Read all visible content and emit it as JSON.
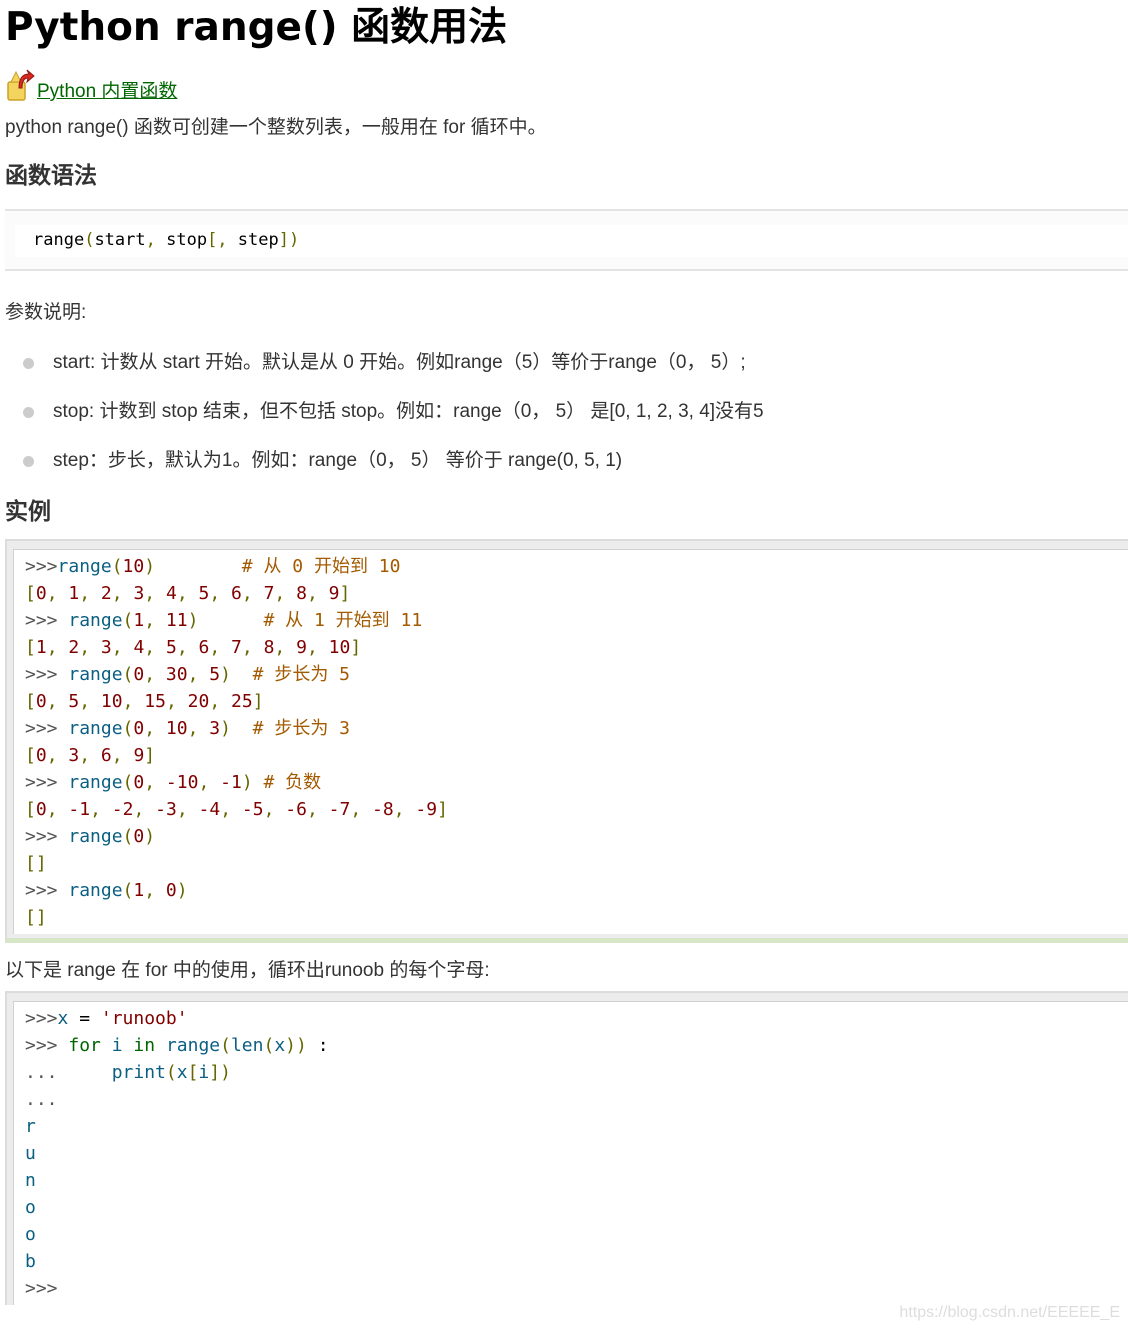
{
  "title": "Python range() 函数用法",
  "back_link": {
    "label": "Python 内置函数",
    "icon": "up-arrow-icon"
  },
  "intro": "python range() 函数可创建一个整数列表，一般用在 for 循环中。",
  "syntax": {
    "heading": "函数语法",
    "code": [
      {
        "t": "range",
        "c": "plainc"
      },
      {
        "t": "(",
        "c": "br"
      },
      {
        "t": "start",
        "c": "plainc"
      },
      {
        "t": ", ",
        "c": "br"
      },
      {
        "t": "stop",
        "c": "plainc"
      },
      {
        "t": "[, ",
        "c": "br"
      },
      {
        "t": "step",
        "c": "plainc"
      },
      {
        "t": "])",
        "c": "br"
      }
    ]
  },
  "params": {
    "heading": "参数说明:",
    "items": [
      "start: 计数从 start 开始。默认是从 0 开始。例如range（5）等价于range（0， 5）;",
      "stop: 计数到 stop 结束，但不包括 stop。例如：range（0， 5） 是[0, 1, 2, 3, 4]没有5",
      "step：步长，默认为1。例如：range（0， 5） 等价于 range(0, 5, 1)"
    ]
  },
  "example": {
    "heading": "实例",
    "lines": [
      [
        {
          "t": ">>>",
          "c": "pr"
        },
        {
          "t": "range",
          "c": "fn"
        },
        {
          "t": "(",
          "c": "br"
        },
        {
          "t": "10",
          "c": "num"
        },
        {
          "t": ")",
          "c": "br"
        },
        {
          "t": "        ",
          "c": "plainc"
        },
        {
          "t": "# 从 0 开始到 10",
          "c": "cm"
        }
      ],
      [
        {
          "t": "[",
          "c": "br"
        },
        {
          "t": "0",
          "c": "num"
        },
        {
          "t": ", ",
          "c": "br"
        },
        {
          "t": "1",
          "c": "num"
        },
        {
          "t": ", ",
          "c": "br"
        },
        {
          "t": "2",
          "c": "num"
        },
        {
          "t": ", ",
          "c": "br"
        },
        {
          "t": "3",
          "c": "num"
        },
        {
          "t": ", ",
          "c": "br"
        },
        {
          "t": "4",
          "c": "num"
        },
        {
          "t": ", ",
          "c": "br"
        },
        {
          "t": "5",
          "c": "num"
        },
        {
          "t": ", ",
          "c": "br"
        },
        {
          "t": "6",
          "c": "num"
        },
        {
          "t": ", ",
          "c": "br"
        },
        {
          "t": "7",
          "c": "num"
        },
        {
          "t": ", ",
          "c": "br"
        },
        {
          "t": "8",
          "c": "num"
        },
        {
          "t": ", ",
          "c": "br"
        },
        {
          "t": "9",
          "c": "num"
        },
        {
          "t": "]",
          "c": "br"
        }
      ],
      [
        {
          "t": ">>> ",
          "c": "pr"
        },
        {
          "t": "range",
          "c": "fn"
        },
        {
          "t": "(",
          "c": "br"
        },
        {
          "t": "1",
          "c": "num"
        },
        {
          "t": ", ",
          "c": "br"
        },
        {
          "t": "11",
          "c": "num"
        },
        {
          "t": ")",
          "c": "br"
        },
        {
          "t": "      ",
          "c": "plainc"
        },
        {
          "t": "# 从 1 开始到 11",
          "c": "cm"
        }
      ],
      [
        {
          "t": "[",
          "c": "br"
        },
        {
          "t": "1",
          "c": "num"
        },
        {
          "t": ", ",
          "c": "br"
        },
        {
          "t": "2",
          "c": "num"
        },
        {
          "t": ", ",
          "c": "br"
        },
        {
          "t": "3",
          "c": "num"
        },
        {
          "t": ", ",
          "c": "br"
        },
        {
          "t": "4",
          "c": "num"
        },
        {
          "t": ", ",
          "c": "br"
        },
        {
          "t": "5",
          "c": "num"
        },
        {
          "t": ", ",
          "c": "br"
        },
        {
          "t": "6",
          "c": "num"
        },
        {
          "t": ", ",
          "c": "br"
        },
        {
          "t": "7",
          "c": "num"
        },
        {
          "t": ", ",
          "c": "br"
        },
        {
          "t": "8",
          "c": "num"
        },
        {
          "t": ", ",
          "c": "br"
        },
        {
          "t": "9",
          "c": "num"
        },
        {
          "t": ", ",
          "c": "br"
        },
        {
          "t": "10",
          "c": "num"
        },
        {
          "t": "]",
          "c": "br"
        }
      ],
      [
        {
          "t": ">>> ",
          "c": "pr"
        },
        {
          "t": "range",
          "c": "fn"
        },
        {
          "t": "(",
          "c": "br"
        },
        {
          "t": "0",
          "c": "num"
        },
        {
          "t": ", ",
          "c": "br"
        },
        {
          "t": "30",
          "c": "num"
        },
        {
          "t": ", ",
          "c": "br"
        },
        {
          "t": "5",
          "c": "num"
        },
        {
          "t": ")",
          "c": "br"
        },
        {
          "t": "  ",
          "c": "plainc"
        },
        {
          "t": "# 步长为 5",
          "c": "cm"
        }
      ],
      [
        {
          "t": "[",
          "c": "br"
        },
        {
          "t": "0",
          "c": "num"
        },
        {
          "t": ", ",
          "c": "br"
        },
        {
          "t": "5",
          "c": "num"
        },
        {
          "t": ", ",
          "c": "br"
        },
        {
          "t": "10",
          "c": "num"
        },
        {
          "t": ", ",
          "c": "br"
        },
        {
          "t": "15",
          "c": "num"
        },
        {
          "t": ", ",
          "c": "br"
        },
        {
          "t": "20",
          "c": "num"
        },
        {
          "t": ", ",
          "c": "br"
        },
        {
          "t": "25",
          "c": "num"
        },
        {
          "t": "]",
          "c": "br"
        }
      ],
      [
        {
          "t": ">>> ",
          "c": "pr"
        },
        {
          "t": "range",
          "c": "fn"
        },
        {
          "t": "(",
          "c": "br"
        },
        {
          "t": "0",
          "c": "num"
        },
        {
          "t": ", ",
          "c": "br"
        },
        {
          "t": "10",
          "c": "num"
        },
        {
          "t": ", ",
          "c": "br"
        },
        {
          "t": "3",
          "c": "num"
        },
        {
          "t": ")",
          "c": "br"
        },
        {
          "t": "  ",
          "c": "plainc"
        },
        {
          "t": "# 步长为 3",
          "c": "cm"
        }
      ],
      [
        {
          "t": "[",
          "c": "br"
        },
        {
          "t": "0",
          "c": "num"
        },
        {
          "t": ", ",
          "c": "br"
        },
        {
          "t": "3",
          "c": "num"
        },
        {
          "t": ", ",
          "c": "br"
        },
        {
          "t": "6",
          "c": "num"
        },
        {
          "t": ", ",
          "c": "br"
        },
        {
          "t": "9",
          "c": "num"
        },
        {
          "t": "]",
          "c": "br"
        }
      ],
      [
        {
          "t": ">>> ",
          "c": "pr"
        },
        {
          "t": "range",
          "c": "fn"
        },
        {
          "t": "(",
          "c": "br"
        },
        {
          "t": "0",
          "c": "num"
        },
        {
          "t": ", ",
          "c": "br"
        },
        {
          "t": "-10",
          "c": "num"
        },
        {
          "t": ", ",
          "c": "br"
        },
        {
          "t": "-1",
          "c": "num"
        },
        {
          "t": ")",
          "c": "br"
        },
        {
          "t": " ",
          "c": "plainc"
        },
        {
          "t": "# 负数",
          "c": "cm"
        }
      ],
      [
        {
          "t": "[",
          "c": "br"
        },
        {
          "t": "0",
          "c": "num"
        },
        {
          "t": ", ",
          "c": "br"
        },
        {
          "t": "-1",
          "c": "num"
        },
        {
          "t": ", ",
          "c": "br"
        },
        {
          "t": "-2",
          "c": "num"
        },
        {
          "t": ", ",
          "c": "br"
        },
        {
          "t": "-3",
          "c": "num"
        },
        {
          "t": ", ",
          "c": "br"
        },
        {
          "t": "-4",
          "c": "num"
        },
        {
          "t": ", ",
          "c": "br"
        },
        {
          "t": "-5",
          "c": "num"
        },
        {
          "t": ", ",
          "c": "br"
        },
        {
          "t": "-6",
          "c": "num"
        },
        {
          "t": ", ",
          "c": "br"
        },
        {
          "t": "-7",
          "c": "num"
        },
        {
          "t": ", ",
          "c": "br"
        },
        {
          "t": "-8",
          "c": "num"
        },
        {
          "t": ", ",
          "c": "br"
        },
        {
          "t": "-9",
          "c": "num"
        },
        {
          "t": "]",
          "c": "br"
        }
      ],
      [
        {
          "t": ">>> ",
          "c": "pr"
        },
        {
          "t": "range",
          "c": "fn"
        },
        {
          "t": "(",
          "c": "br"
        },
        {
          "t": "0",
          "c": "num"
        },
        {
          "t": ")",
          "c": "br"
        }
      ],
      [
        {
          "t": "[]",
          "c": "br"
        }
      ],
      [
        {
          "t": ">>> ",
          "c": "pr"
        },
        {
          "t": "range",
          "c": "fn"
        },
        {
          "t": "(",
          "c": "br"
        },
        {
          "t": "1",
          "c": "num"
        },
        {
          "t": ", ",
          "c": "br"
        },
        {
          "t": "0",
          "c": "num"
        },
        {
          "t": ")",
          "c": "br"
        }
      ],
      [
        {
          "t": "[]",
          "c": "br"
        }
      ]
    ]
  },
  "for_desc": "以下是 range 在 for 中的使用，循环出runoob 的每个字母:",
  "example2": {
    "lines": [
      [
        {
          "t": ">>>",
          "c": "pr"
        },
        {
          "t": "x",
          "c": "fn"
        },
        {
          "t": " = ",
          "c": "plainc"
        },
        {
          "t": "'runoob'",
          "c": "str"
        }
      ],
      [
        {
          "t": ">>> ",
          "c": "pr"
        },
        {
          "t": "for",
          "c": "kw"
        },
        {
          "t": " ",
          "c": "plainc"
        },
        {
          "t": "i",
          "c": "fn"
        },
        {
          "t": " ",
          "c": "plainc"
        },
        {
          "t": "in",
          "c": "kw"
        },
        {
          "t": " ",
          "c": "plainc"
        },
        {
          "t": "range",
          "c": "fn"
        },
        {
          "t": "(",
          "c": "br"
        },
        {
          "t": "len",
          "c": "fn"
        },
        {
          "t": "(",
          "c": "br"
        },
        {
          "t": "x",
          "c": "fn"
        },
        {
          "t": "))",
          "c": "br"
        },
        {
          "t": " :",
          "c": "plainc"
        }
      ],
      [
        {
          "t": "...     ",
          "c": "pr"
        },
        {
          "t": "print",
          "c": "fn"
        },
        {
          "t": "(",
          "c": "br"
        },
        {
          "t": "x",
          "c": "fn"
        },
        {
          "t": "[",
          "c": "br"
        },
        {
          "t": "i",
          "c": "fn"
        },
        {
          "t": "])",
          "c": "br"
        }
      ],
      [
        {
          "t": "...",
          "c": "pr"
        }
      ],
      [
        {
          "t": "r",
          "c": "fn"
        }
      ],
      [
        {
          "t": "u",
          "c": "fn"
        }
      ],
      [
        {
          "t": "n",
          "c": "fn"
        }
      ],
      [
        {
          "t": "o",
          "c": "fn"
        }
      ],
      [
        {
          "t": "o",
          "c": "fn"
        }
      ],
      [
        {
          "t": "b",
          "c": "fn"
        }
      ],
      [
        {
          "t": ">>>",
          "c": "pr"
        }
      ]
    ]
  },
  "watermark": "https://blog.csdn.net/EEEEE_E",
  "colors": {
    "link": "#006600",
    "code_fn": "#0b5f82",
    "code_num": "#800000",
    "code_comment": "#a35a00"
  }
}
